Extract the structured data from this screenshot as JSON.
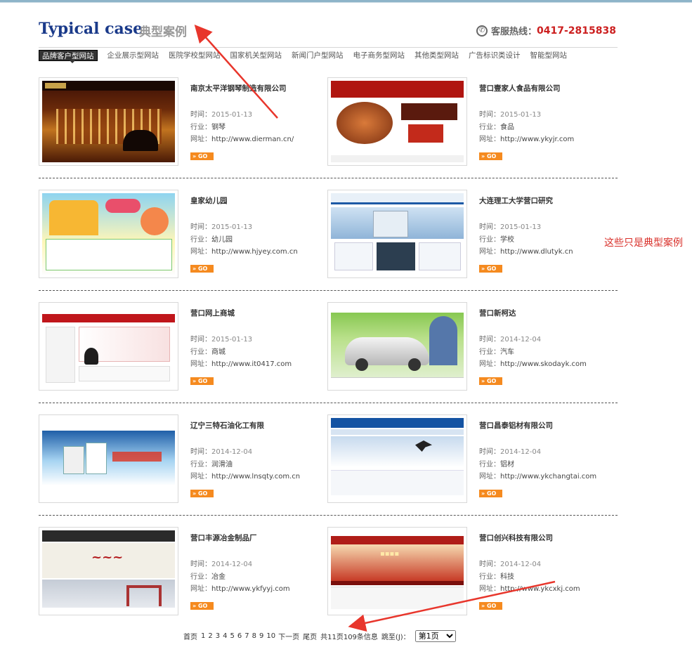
{
  "header": {
    "title_en": "Typical case",
    "title_cn": "典型案例",
    "hotline_label": "客服热线：",
    "hotline_number": "0417-2815838"
  },
  "nav": {
    "items": [
      {
        "label": "品牌客户型网站",
        "active": true
      },
      {
        "label": "企业展示型网站"
      },
      {
        "label": "医院学校型网站"
      },
      {
        "label": "国家机关型网站"
      },
      {
        "label": "新闻门户型网站"
      },
      {
        "label": "电子商务型网站"
      },
      {
        "label": "其他类型网站"
      },
      {
        "label": "广告标识类设计"
      },
      {
        "label": "智能型网站"
      }
    ]
  },
  "labels": {
    "time": "时间：",
    "industry": "行业：",
    "url": "网址：",
    "go": "» GO"
  },
  "cases": [
    {
      "name": "南京太平洋钢琴制造有限公司",
      "date": "2015-01-13",
      "industry": "钢琴",
      "url": "http://www.dierman.cn/",
      "theme": "piano"
    },
    {
      "name": "营口壹家人食品有限公司",
      "date": "2015-01-13",
      "industry": "食品",
      "url": "http://www.ykyjr.com",
      "theme": "food"
    },
    {
      "name": "皇家幼儿园",
      "date": "2015-01-13",
      "industry": "幼儿园",
      "url": "http://www.hjyey.com.cn",
      "theme": "kinder"
    },
    {
      "name": "大连理工大学营口研究",
      "date": "2015-01-13",
      "industry": "学校",
      "url": "http://www.dlutyk.cn",
      "theme": "univ"
    },
    {
      "name": "营口网上商城",
      "date": "2015-01-13",
      "industry": "商城",
      "url": "http://www.it0417.com",
      "theme": "mall"
    },
    {
      "name": "营口新柯达",
      "date": "2014-12-04",
      "industry": "汽车",
      "url": "http://www.skodayk.com",
      "theme": "car"
    },
    {
      "name": "辽宁三特石油化工有限",
      "date": "2014-12-04",
      "industry": "润滑油",
      "url": "http://www.lnsqty.com.cn",
      "theme": "oil"
    },
    {
      "name": "营口昌泰铝材有限公司",
      "date": "2014-12-04",
      "industry": "铝材",
      "url": "http://www.ykchangtai.com",
      "theme": "alu"
    },
    {
      "name": "营口丰源冶金制品厂",
      "date": "2014-12-04",
      "industry": "冶金",
      "url": "http://www.ykfyyj.com",
      "theme": "metal"
    },
    {
      "name": "营口创兴科技有限公司",
      "date": "2014-12-04",
      "industry": "科技",
      "url": "http://www.ykcxkj.com",
      "theme": "tech"
    }
  ],
  "pager": {
    "first": "首页",
    "pages": [
      "1",
      "2",
      "3",
      "4",
      "5",
      "6",
      "7",
      "8",
      "9",
      "10"
    ],
    "next": "下一页",
    "last": "尾页",
    "summary": "共11页109条信息",
    "jump_label": "跳至(J)：",
    "selected": "第1页"
  },
  "annotation": {
    "note": "这些只是典型案例"
  },
  "colors": {
    "title_blue": "#1a3a8a",
    "hotline_red": "#cc1f1f",
    "go_orange": "#f58a1f",
    "arrow_red": "#e8362c"
  }
}
